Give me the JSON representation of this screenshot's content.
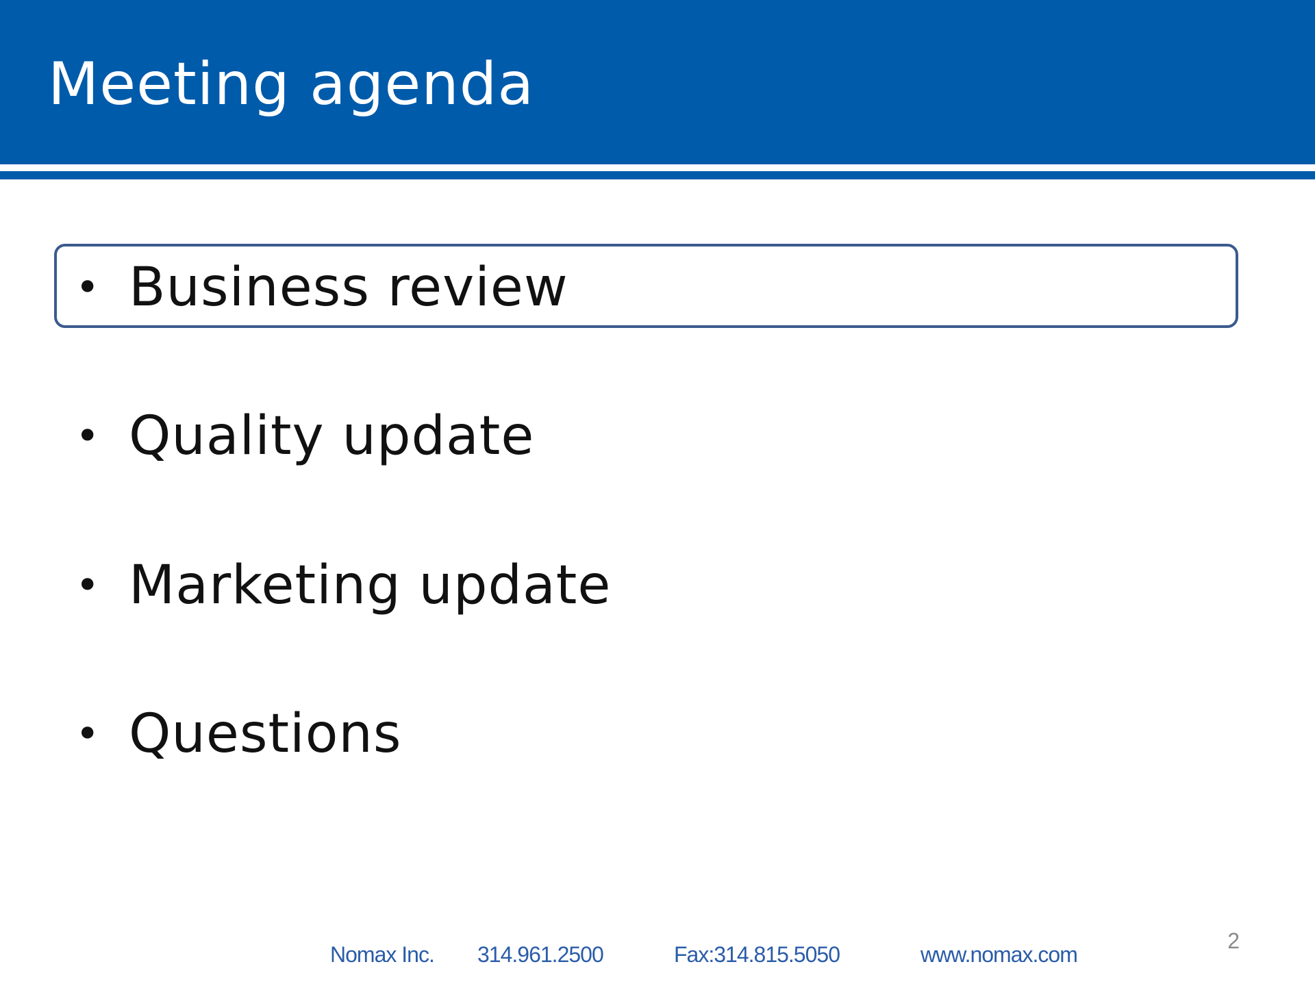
{
  "slide": {
    "title": "Meeting agenda",
    "page_number": "2"
  },
  "agenda": {
    "items": [
      {
        "label": "Business review",
        "highlighted": true
      },
      {
        "label": "Quality update",
        "highlighted": false
      },
      {
        "label": "Marketing update",
        "highlighted": false
      },
      {
        "label": "Questions",
        "highlighted": false
      }
    ],
    "bullet": "•"
  },
  "footer": {
    "company": "Nomax Inc.",
    "phone": "314.961.2500",
    "fax": "Fax:314.815.5050",
    "website": "www.nomax.com"
  },
  "colors": {
    "brand_blue": "#005bab",
    "highlight_border": "#3b5b8e",
    "footer_text": "#2a5ca8"
  }
}
